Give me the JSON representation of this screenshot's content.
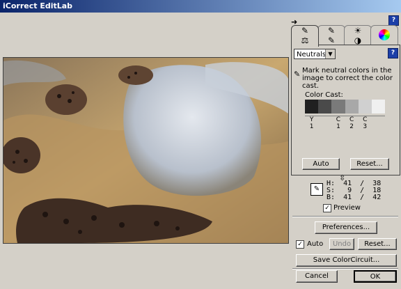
{
  "window": {
    "title": "iCorrect EditLab"
  },
  "preview": {
    "description_icon": "rock-photo"
  },
  "panel": {
    "tabs": [
      {
        "name": "neutrals-tab",
        "icons": [
          "dropper-icon",
          "scale-icon"
        ]
      },
      {
        "name": "color-tab",
        "icons": [
          "dropper-icon",
          "dropper-icon"
        ]
      },
      {
        "name": "brightness-tab",
        "icons": [
          "sun-icon",
          "contrast-icon"
        ]
      },
      {
        "name": "color-wheel-tab",
        "icons": [
          "color-wheel-icon"
        ]
      }
    ],
    "mode": "Neutrals",
    "instruction": "Mark neutral colors in the image to correct the color cast.",
    "color_cast_label": "Color Cast:",
    "swatch_colors": [
      "#202020",
      "#4a4a4a",
      "#7a7a7a",
      "#a8a8a8",
      "#d0d0d0",
      "#f0f0f0"
    ],
    "swatch_labels": [
      {
        "top": "Y",
        "bottom": "1"
      },
      {
        "top": "",
        "bottom": ""
      },
      {
        "top": "C",
        "bottom": "1"
      },
      {
        "top": "C",
        "bottom": "2"
      },
      {
        "top": "C",
        "bottom": "3"
      },
      {
        "top": "",
        "bottom": ""
      }
    ],
    "auto_label": "Auto",
    "reset_label": "Reset..."
  },
  "hsb": {
    "h": "H:  41  /  38",
    "s": "S:   9  /  18",
    "b": "B:  41  /  42"
  },
  "preview_toggle": {
    "label": "Preview",
    "checked": true
  },
  "buttons": {
    "preferences": "Preferences...",
    "auto_check_label": "Auto",
    "undo": "Undo",
    "reset": "Reset...",
    "save": "Save ColorCircuit...",
    "cancel": "Cancel",
    "ok": "OK"
  },
  "help_icon": "?"
}
